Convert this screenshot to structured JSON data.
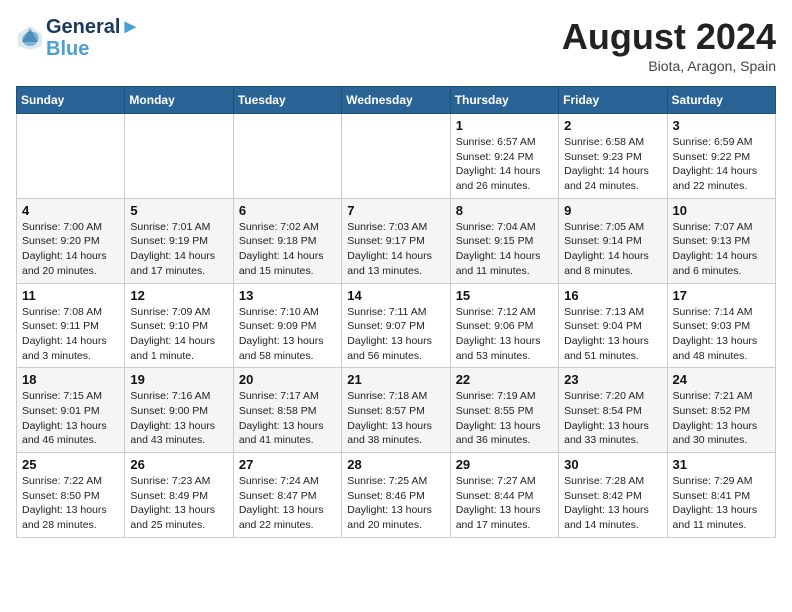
{
  "header": {
    "logo_line1": "General",
    "logo_line2": "Blue",
    "month": "August 2024",
    "location": "Biota, Aragon, Spain"
  },
  "days_of_week": [
    "Sunday",
    "Monday",
    "Tuesday",
    "Wednesday",
    "Thursday",
    "Friday",
    "Saturday"
  ],
  "weeks": [
    [
      {
        "day": "",
        "info": ""
      },
      {
        "day": "",
        "info": ""
      },
      {
        "day": "",
        "info": ""
      },
      {
        "day": "",
        "info": ""
      },
      {
        "day": "1",
        "info": "Sunrise: 6:57 AM\nSunset: 9:24 PM\nDaylight: 14 hours and 26 minutes."
      },
      {
        "day": "2",
        "info": "Sunrise: 6:58 AM\nSunset: 9:23 PM\nDaylight: 14 hours and 24 minutes."
      },
      {
        "day": "3",
        "info": "Sunrise: 6:59 AM\nSunset: 9:22 PM\nDaylight: 14 hours and 22 minutes."
      }
    ],
    [
      {
        "day": "4",
        "info": "Sunrise: 7:00 AM\nSunset: 9:20 PM\nDaylight: 14 hours and 20 minutes."
      },
      {
        "day": "5",
        "info": "Sunrise: 7:01 AM\nSunset: 9:19 PM\nDaylight: 14 hours and 17 minutes."
      },
      {
        "day": "6",
        "info": "Sunrise: 7:02 AM\nSunset: 9:18 PM\nDaylight: 14 hours and 15 minutes."
      },
      {
        "day": "7",
        "info": "Sunrise: 7:03 AM\nSunset: 9:17 PM\nDaylight: 14 hours and 13 minutes."
      },
      {
        "day": "8",
        "info": "Sunrise: 7:04 AM\nSunset: 9:15 PM\nDaylight: 14 hours and 11 minutes."
      },
      {
        "day": "9",
        "info": "Sunrise: 7:05 AM\nSunset: 9:14 PM\nDaylight: 14 hours and 8 minutes."
      },
      {
        "day": "10",
        "info": "Sunrise: 7:07 AM\nSunset: 9:13 PM\nDaylight: 14 hours and 6 minutes."
      }
    ],
    [
      {
        "day": "11",
        "info": "Sunrise: 7:08 AM\nSunset: 9:11 PM\nDaylight: 14 hours and 3 minutes."
      },
      {
        "day": "12",
        "info": "Sunrise: 7:09 AM\nSunset: 9:10 PM\nDaylight: 14 hours and 1 minute."
      },
      {
        "day": "13",
        "info": "Sunrise: 7:10 AM\nSunset: 9:09 PM\nDaylight: 13 hours and 58 minutes."
      },
      {
        "day": "14",
        "info": "Sunrise: 7:11 AM\nSunset: 9:07 PM\nDaylight: 13 hours and 56 minutes."
      },
      {
        "day": "15",
        "info": "Sunrise: 7:12 AM\nSunset: 9:06 PM\nDaylight: 13 hours and 53 minutes."
      },
      {
        "day": "16",
        "info": "Sunrise: 7:13 AM\nSunset: 9:04 PM\nDaylight: 13 hours and 51 minutes."
      },
      {
        "day": "17",
        "info": "Sunrise: 7:14 AM\nSunset: 9:03 PM\nDaylight: 13 hours and 48 minutes."
      }
    ],
    [
      {
        "day": "18",
        "info": "Sunrise: 7:15 AM\nSunset: 9:01 PM\nDaylight: 13 hours and 46 minutes."
      },
      {
        "day": "19",
        "info": "Sunrise: 7:16 AM\nSunset: 9:00 PM\nDaylight: 13 hours and 43 minutes."
      },
      {
        "day": "20",
        "info": "Sunrise: 7:17 AM\nSunset: 8:58 PM\nDaylight: 13 hours and 41 minutes."
      },
      {
        "day": "21",
        "info": "Sunrise: 7:18 AM\nSunset: 8:57 PM\nDaylight: 13 hours and 38 minutes."
      },
      {
        "day": "22",
        "info": "Sunrise: 7:19 AM\nSunset: 8:55 PM\nDaylight: 13 hours and 36 minutes."
      },
      {
        "day": "23",
        "info": "Sunrise: 7:20 AM\nSunset: 8:54 PM\nDaylight: 13 hours and 33 minutes."
      },
      {
        "day": "24",
        "info": "Sunrise: 7:21 AM\nSunset: 8:52 PM\nDaylight: 13 hours and 30 minutes."
      }
    ],
    [
      {
        "day": "25",
        "info": "Sunrise: 7:22 AM\nSunset: 8:50 PM\nDaylight: 13 hours and 28 minutes."
      },
      {
        "day": "26",
        "info": "Sunrise: 7:23 AM\nSunset: 8:49 PM\nDaylight: 13 hours and 25 minutes."
      },
      {
        "day": "27",
        "info": "Sunrise: 7:24 AM\nSunset: 8:47 PM\nDaylight: 13 hours and 22 minutes."
      },
      {
        "day": "28",
        "info": "Sunrise: 7:25 AM\nSunset: 8:46 PM\nDaylight: 13 hours and 20 minutes."
      },
      {
        "day": "29",
        "info": "Sunrise: 7:27 AM\nSunset: 8:44 PM\nDaylight: 13 hours and 17 minutes."
      },
      {
        "day": "30",
        "info": "Sunrise: 7:28 AM\nSunset: 8:42 PM\nDaylight: 13 hours and 14 minutes."
      },
      {
        "day": "31",
        "info": "Sunrise: 7:29 AM\nSunset: 8:41 PM\nDaylight: 13 hours and 11 minutes."
      }
    ]
  ]
}
